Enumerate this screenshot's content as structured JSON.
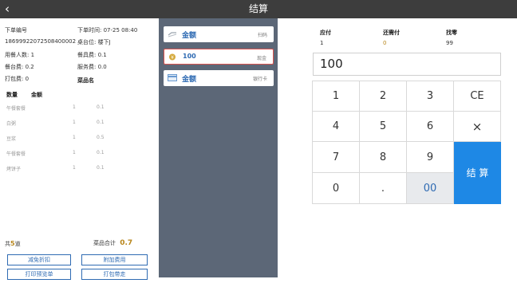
{
  "header": {
    "title": "结算",
    "back": "‹"
  },
  "order": {
    "no_label": "下单编号",
    "no_value": "18699922072508400002",
    "time_label": "下单时间: 07-25 08:40",
    "table_label": "桌台位: 楼下J",
    "diners_label": "用餐人数: 1",
    "tableware_label": "餐具费: 0.1",
    "seat_fee_label": "餐台费: 0.2",
    "service_label": "服务费: 0.0",
    "pack_label": "打包费: 0"
  },
  "items_header": {
    "qty": "数量",
    "amount": "金额",
    "name": "菜品名"
  },
  "items": [
    {
      "name": "午餐套餐",
      "qty": "1",
      "amount": "0.1"
    },
    {
      "name": "白粥",
      "qty": "1",
      "amount": "0.1"
    },
    {
      "name": "豆浆",
      "qty": "1",
      "amount": "0.5"
    },
    {
      "name": "午餐套餐",
      "qty": "1",
      "amount": "0.1"
    },
    {
      "name": "烤饼子",
      "qty": "1",
      "amount": "0.1"
    }
  ],
  "summary": {
    "count_prefix": "共",
    "count": "5",
    "count_suffix": "道",
    "total_label": "菜品合计",
    "total": "0.7"
  },
  "left_buttons": [
    "减免折扣",
    "附加费用",
    "打印预览单",
    "打包带走"
  ],
  "payments": [
    {
      "label": "金额",
      "type": "扫码",
      "icon": "scan-icon"
    },
    {
      "label": "100",
      "type": "现金",
      "icon": "cash-icon"
    },
    {
      "label": "金额",
      "type": "银行卡",
      "icon": "bank-card-icon"
    }
  ],
  "totals": {
    "due_label": "应付",
    "due": "1",
    "remaining_label": "还需付",
    "remaining": "0",
    "change_label": "找零",
    "change": "99"
  },
  "amount_input": "100",
  "keypad": {
    "row1": [
      "1",
      "2",
      "3",
      "CE"
    ],
    "row2": [
      "4",
      "5",
      "6",
      "×"
    ],
    "row3": [
      "7",
      "8",
      "9"
    ],
    "row4": [
      "0",
      ".",
      "00"
    ],
    "settle": "结 算"
  },
  "colors": {
    "accent": "#2f6bb3",
    "settle": "#1e88e5",
    "panel": "#5c6777",
    "selected_border": "#d9534f",
    "money": "#b8861b"
  }
}
